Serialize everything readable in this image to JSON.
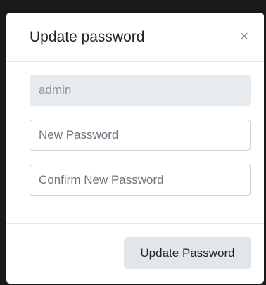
{
  "dialog": {
    "title": "Update password",
    "close_glyph": "×",
    "close_icon": "close-icon"
  },
  "form": {
    "username_value": "admin",
    "new_password_placeholder": "New Password",
    "confirm_password_placeholder": "Confirm New Password"
  },
  "footer": {
    "update_label": "Update Password"
  },
  "colors": {
    "backdrop": "#1a1a1a",
    "dialog_background": "#ffffff",
    "disabled_field": "#e9ecef",
    "button_background": "#e2e6ea",
    "border": "#ced4da"
  }
}
